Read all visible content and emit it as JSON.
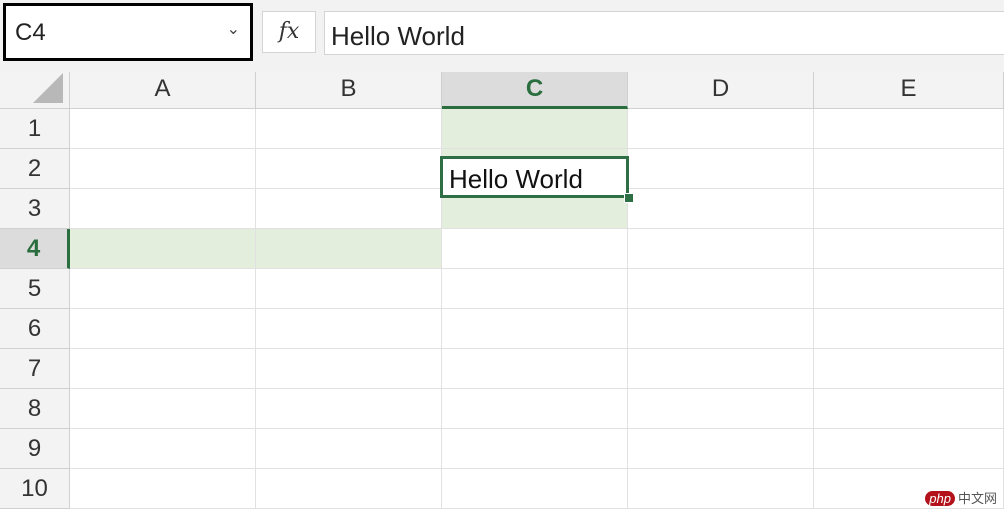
{
  "formula_bar": {
    "name_box_value": "C4",
    "fx_label": "fx",
    "formula_value": "Hello World"
  },
  "columns": [
    "A",
    "B",
    "C",
    "D",
    "E"
  ],
  "rows": [
    "1",
    "2",
    "3",
    "4",
    "5",
    "6",
    "7",
    "8",
    "9",
    "10"
  ],
  "active_cell": {
    "ref": "C4",
    "value": "Hello World"
  },
  "colors": {
    "accent": "#2a6e3f",
    "highlight": "#e3efdc"
  },
  "watermark": {
    "logo": "php",
    "text": "中文网"
  }
}
